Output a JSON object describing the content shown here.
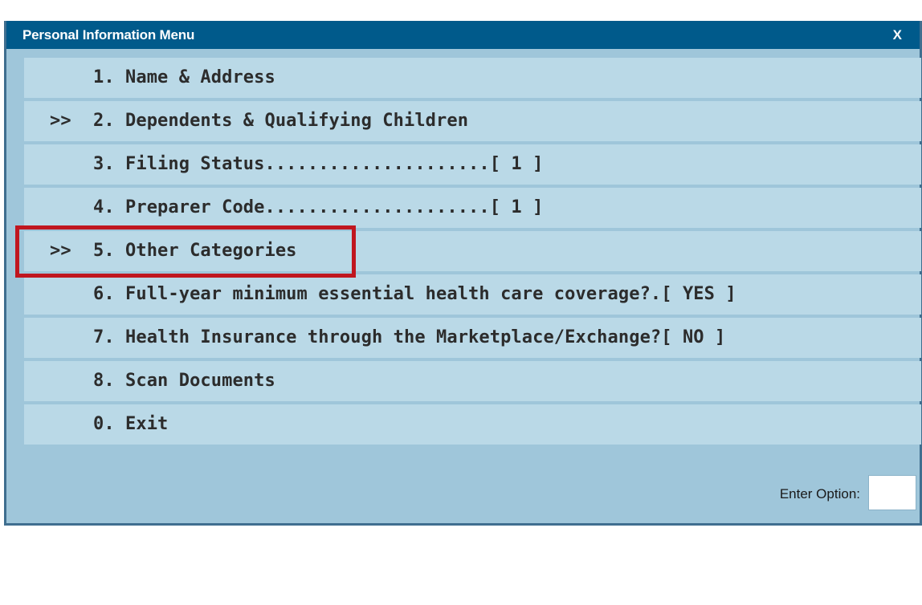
{
  "window": {
    "title": "Personal Information Menu",
    "close_label": "X"
  },
  "menu": {
    "items": [
      {
        "marker": "",
        "number": "1.",
        "text": "Name & Address"
      },
      {
        "marker": ">>",
        "number": "2.",
        "text": "Dependents & Qualifying Children"
      },
      {
        "marker": "",
        "number": "3.",
        "text": "Filing Status.....................[ 1 ]"
      },
      {
        "marker": "",
        "number": "4.",
        "text": "Preparer Code.....................[ 1 ]"
      },
      {
        "marker": ">>",
        "number": "5.",
        "text": "Other Categories"
      },
      {
        "marker": "",
        "number": "6.",
        "text": "Full-year minimum essential health care coverage?.[ YES ]"
      },
      {
        "marker": "",
        "number": "7.",
        "text": "Health Insurance through the Marketplace/Exchange?[ NO ]"
      },
      {
        "marker": "",
        "number": "8.",
        "text": "Scan Documents"
      },
      {
        "marker": "",
        "number": "0.",
        "text": "Exit"
      }
    ]
  },
  "option": {
    "label": "Enter Option:",
    "value": ""
  },
  "colors": {
    "titlebar": "#005a8b",
    "panel": "#9fc6da",
    "row": "#bad9e7",
    "highlight": "#c0161f"
  }
}
